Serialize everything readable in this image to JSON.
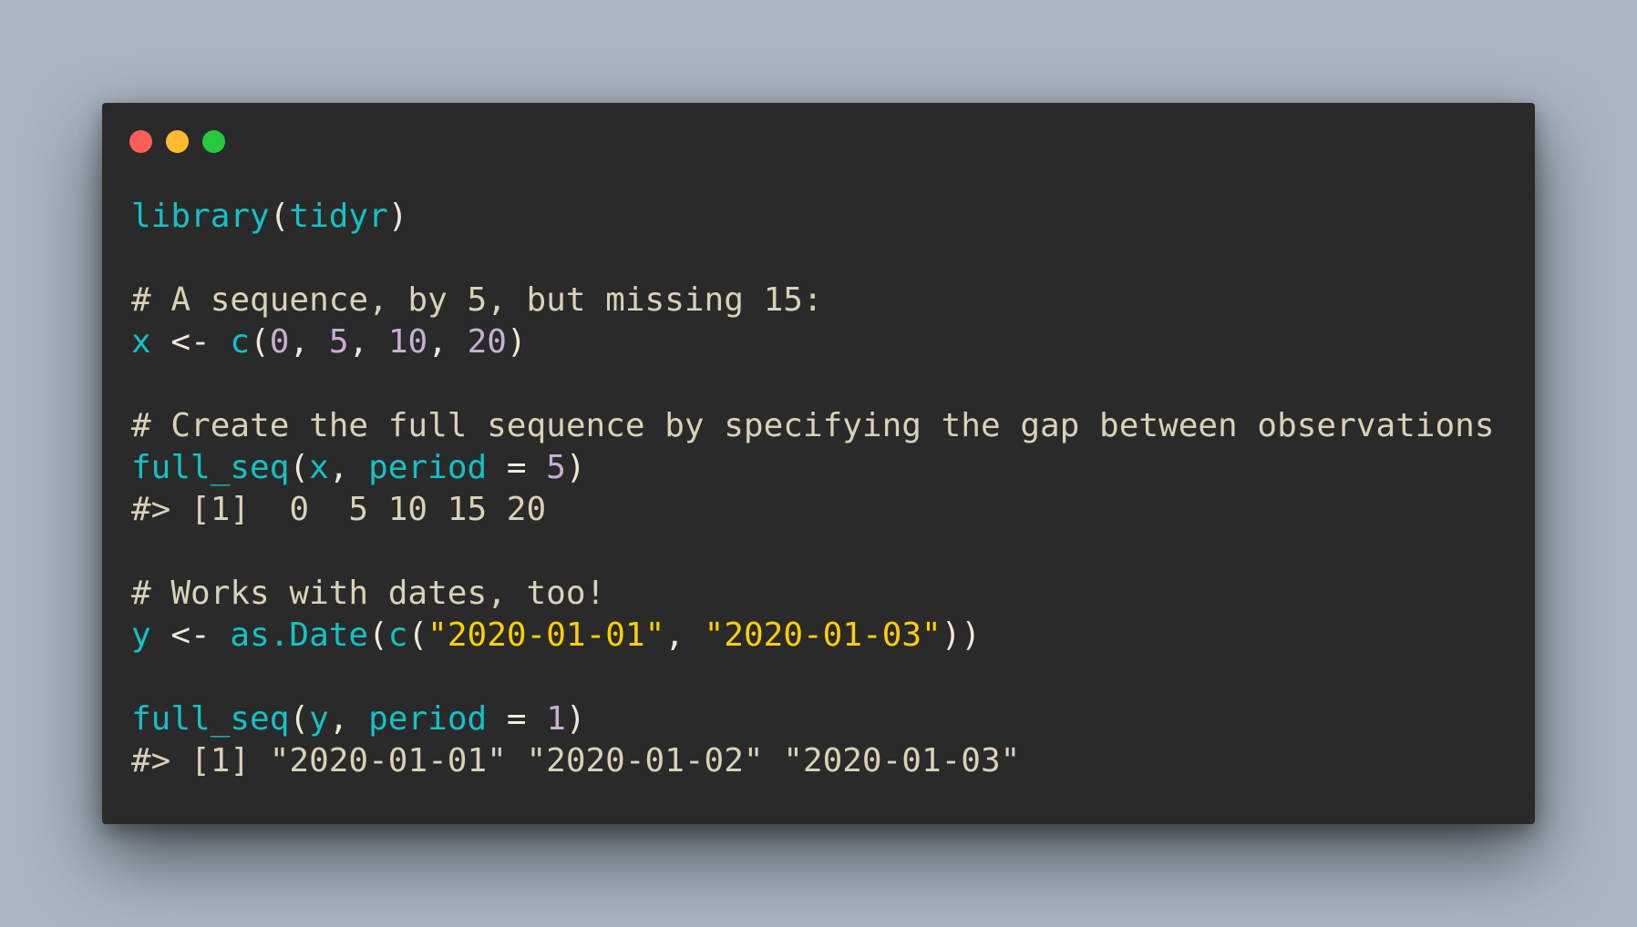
{
  "window_controls": {
    "close": "close",
    "minimize": "minimize",
    "maximize": "maximize"
  },
  "code": [
    [
      {
        "t": "library",
        "c": "fn"
      },
      {
        "t": "(",
        "c": "punct"
      },
      {
        "t": "tidyr",
        "c": "fn"
      },
      {
        "t": ")",
        "c": "punct"
      }
    ],
    [],
    [
      {
        "t": "# A sequence, by 5, but missing 15:",
        "c": "comment"
      }
    ],
    [
      {
        "t": "x",
        "c": "id"
      },
      {
        "t": " <- ",
        "c": "op"
      },
      {
        "t": "c",
        "c": "fn"
      },
      {
        "t": "(",
        "c": "punct"
      },
      {
        "t": "0",
        "c": "num"
      },
      {
        "t": ", ",
        "c": "punct"
      },
      {
        "t": "5",
        "c": "num"
      },
      {
        "t": ", ",
        "c": "punct"
      },
      {
        "t": "10",
        "c": "num"
      },
      {
        "t": ", ",
        "c": "punct"
      },
      {
        "t": "20",
        "c": "num"
      },
      {
        "t": ")",
        "c": "punct"
      }
    ],
    [],
    [
      {
        "t": "# Create the full sequence by specifying the gap between observations",
        "c": "comment"
      }
    ],
    [
      {
        "t": "full_seq",
        "c": "fn"
      },
      {
        "t": "(",
        "c": "punct"
      },
      {
        "t": "x",
        "c": "id"
      },
      {
        "t": ", ",
        "c": "punct"
      },
      {
        "t": "period",
        "c": "arg"
      },
      {
        "t": " = ",
        "c": "op"
      },
      {
        "t": "5",
        "c": "num"
      },
      {
        "t": ")",
        "c": "punct"
      }
    ],
    [
      {
        "t": "#> [1]  0  5 10 15 20",
        "c": "output"
      }
    ],
    [],
    [
      {
        "t": "# Works with dates, too!",
        "c": "comment"
      }
    ],
    [
      {
        "t": "y",
        "c": "id"
      },
      {
        "t": " <- ",
        "c": "op"
      },
      {
        "t": "as.Date",
        "c": "fn"
      },
      {
        "t": "(",
        "c": "punct"
      },
      {
        "t": "c",
        "c": "fn"
      },
      {
        "t": "(",
        "c": "punct"
      },
      {
        "t": "\"2020-01-01\"",
        "c": "str"
      },
      {
        "t": ", ",
        "c": "punct"
      },
      {
        "t": "\"2020-01-03\"",
        "c": "str"
      },
      {
        "t": "))",
        "c": "punct"
      }
    ],
    [],
    [
      {
        "t": "full_seq",
        "c": "fn"
      },
      {
        "t": "(",
        "c": "punct"
      },
      {
        "t": "y",
        "c": "id"
      },
      {
        "t": ", ",
        "c": "punct"
      },
      {
        "t": "period",
        "c": "arg"
      },
      {
        "t": " = ",
        "c": "op"
      },
      {
        "t": "1",
        "c": "num"
      },
      {
        "t": ")",
        "c": "punct"
      }
    ],
    [
      {
        "t": "#> [1] \"2020-01-01\" \"2020-01-02\" \"2020-01-03\"",
        "c": "output"
      }
    ]
  ]
}
